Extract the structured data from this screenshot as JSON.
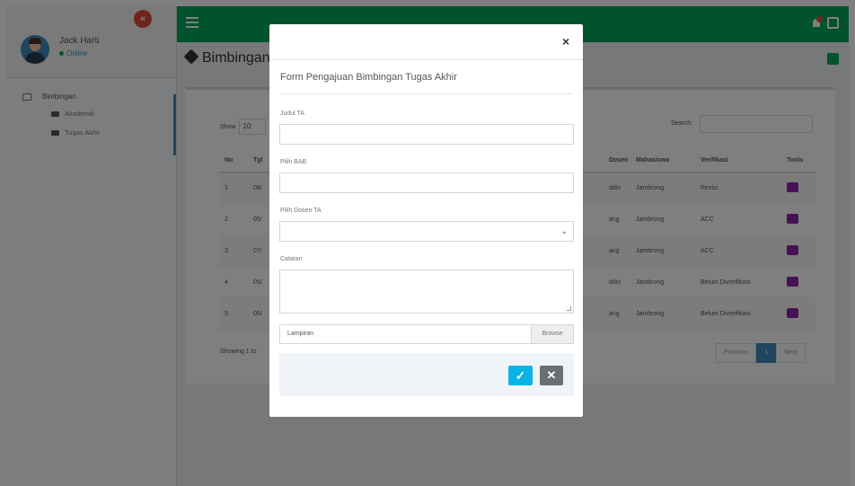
{
  "user": {
    "name": "Jack Harti",
    "status": "Online"
  },
  "sidebar": {
    "toggle_icon": "«",
    "menu_label": "Bimbingan",
    "items": [
      {
        "label": "Akademik"
      },
      {
        "label": "Tugas Akhir"
      }
    ]
  },
  "page": {
    "title": "Bimbingan"
  },
  "table": {
    "show_label": "Show",
    "entries": "10",
    "search_label": "Search:",
    "headers": [
      "No",
      "Tgl",
      "Dosen",
      "Mahasiswa",
      "Verifikasi",
      "Tools"
    ],
    "rows": [
      {
        "no": "1",
        "tgl": "08/",
        "dosen": "ddin",
        "mhs": "Jambrong",
        "ver": "Revisi"
      },
      {
        "no": "2",
        "tgl": "05/",
        "dosen": "ang",
        "mhs": "Jambrong",
        "ver": "ACC"
      },
      {
        "no": "3",
        "tgl": "07/",
        "dosen": "ang",
        "mhs": "Jambrong",
        "ver": "ACC"
      },
      {
        "no": "4",
        "tgl": "05/",
        "dosen": "ddin",
        "mhs": "Jambrong",
        "ver": "Belum Diverifikasi"
      },
      {
        "no": "5",
        "tgl": "06/",
        "dosen": "ang",
        "mhs": "Jambrong",
        "ver": "Belum Diverifikasi"
      }
    ],
    "showing": "Showing 1 to",
    "pagination": {
      "previous": "Previous",
      "current": "1",
      "next": "Next"
    }
  },
  "modal": {
    "close": "×",
    "title": "Form Pengajuan Bimbingan Tugas Akhir",
    "labels": {
      "judul": "Judul TA",
      "bab": "Pilih BAB",
      "dosen": "Pilih Dosen TA",
      "catatan": "Catatan"
    },
    "file_placeholder": "Lampiran",
    "browse": "Browse",
    "ok_icon": "✓",
    "cancel_icon": "✕"
  },
  "colors": {
    "topbar": "#00a65a",
    "primary": "#3c8dbc",
    "ok": "#0bb4e6",
    "danger": "#dd4b39",
    "tool": "#8e24aa"
  }
}
